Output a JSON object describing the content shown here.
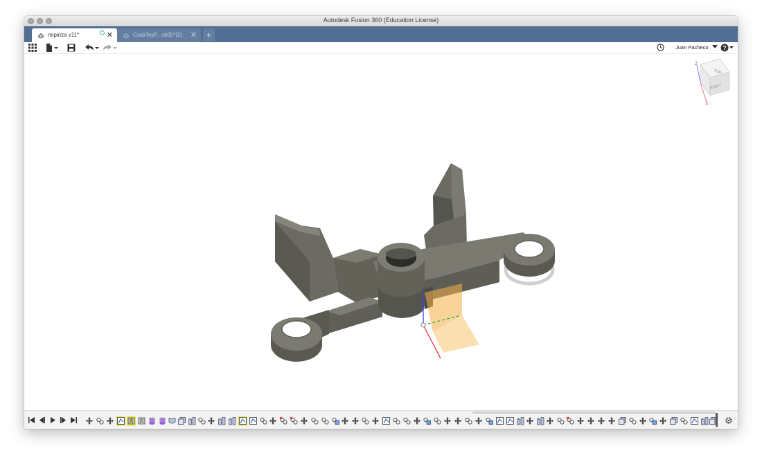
{
  "window": {
    "title": "Autodesk Fusion 360 (Education License)"
  },
  "tabs": [
    {
      "label": "mipinza v11*",
      "close": "✕"
    },
    {
      "label": "GrabToyP...ck05*(2)",
      "close": "✕"
    }
  ],
  "new_tab": "+",
  "toolbar": {
    "data_panel_icon": "grid-icon",
    "file_icon": "file-icon",
    "save_icon": "save-icon",
    "undo_icon": "undo-icon",
    "redo_icon": "redo-icon",
    "job_status_icon": "clock-icon",
    "user_name": "Juan Pacheco",
    "help_icon": "help-icon"
  },
  "viewcube": {
    "top": "TOP",
    "right": "RIGHT",
    "axis_z": "Z",
    "axis_x": "X"
  },
  "colors": {
    "tab_bar": "#526e92",
    "model": "#6c6c63",
    "sketch_plane": "#f7b04a",
    "highlight": "#e8e54a"
  },
  "timeline": {
    "controls": [
      "skip-to-start",
      "step-back",
      "play",
      "step-forward",
      "skip-to-end"
    ]
  }
}
